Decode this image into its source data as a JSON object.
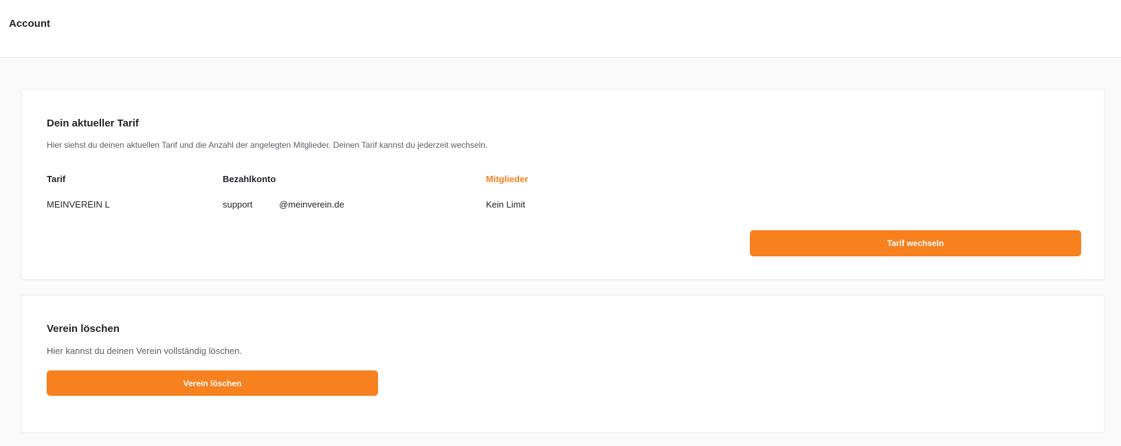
{
  "header": {
    "title": "Account"
  },
  "tarif_card": {
    "heading": "Dein aktueller Tarif",
    "description": "Hier siehst du deinen aktuellen Tarif und die Anzahl der angelegten Mitglieder. Deinen Tarif kannst du jederzeit wechseln.",
    "columns": {
      "tarif": {
        "label": "Tarif",
        "value": "MEINVEREIN L"
      },
      "bezahlkonto": {
        "label": "Bezahlkonto",
        "value_user": "support",
        "value_domain": "@meinverein.de"
      },
      "mitglieder": {
        "label": "Mitglieder",
        "value": "Kein Limit"
      }
    },
    "button_label": "Tarif wechseln"
  },
  "delete_card": {
    "heading": "Verein löschen",
    "description": "Hier kannst du deinen Verein vollständig löschen.",
    "button_label": "Verein löschen"
  },
  "colors": {
    "accent": "#f7801f",
    "background": "#fafafa",
    "card": "#ffffff"
  }
}
